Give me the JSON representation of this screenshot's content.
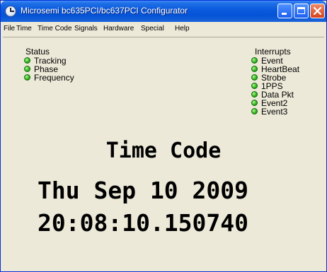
{
  "window": {
    "title": "Microsemi bc635PCI/bc637PCI Configurator"
  },
  "menu": [
    {
      "label": "File"
    },
    {
      "label": "Time"
    },
    {
      "label": "Time Code"
    },
    {
      "label": "Signals"
    },
    {
      "label": "Hardware"
    },
    {
      "label": "Special"
    },
    {
      "label": "Help"
    }
  ],
  "status": {
    "heading": "Status",
    "items": [
      {
        "label": "Tracking",
        "state": "on"
      },
      {
        "label": "Phase",
        "state": "on"
      },
      {
        "label": "Frequency",
        "state": "on"
      }
    ]
  },
  "interrupts": {
    "heading": "Interrupts",
    "items": [
      {
        "label": "Event",
        "state": "on"
      },
      {
        "label": "HeartBeat",
        "state": "on"
      },
      {
        "label": "Strobe",
        "state": "on"
      },
      {
        "label": "1PPS",
        "state": "on"
      },
      {
        "label": "Data Pkt",
        "state": "on"
      },
      {
        "label": "Event2",
        "state": "on"
      },
      {
        "label": "Event3",
        "state": "on"
      }
    ]
  },
  "time_display": {
    "label": "Time Code",
    "date": "Thu Sep 10 2009",
    "time": "20:08:10.150740"
  },
  "colors": {
    "titlebar": "#0a58dc",
    "led_green": "#33b81d",
    "window_bg": "#ece9d8"
  }
}
